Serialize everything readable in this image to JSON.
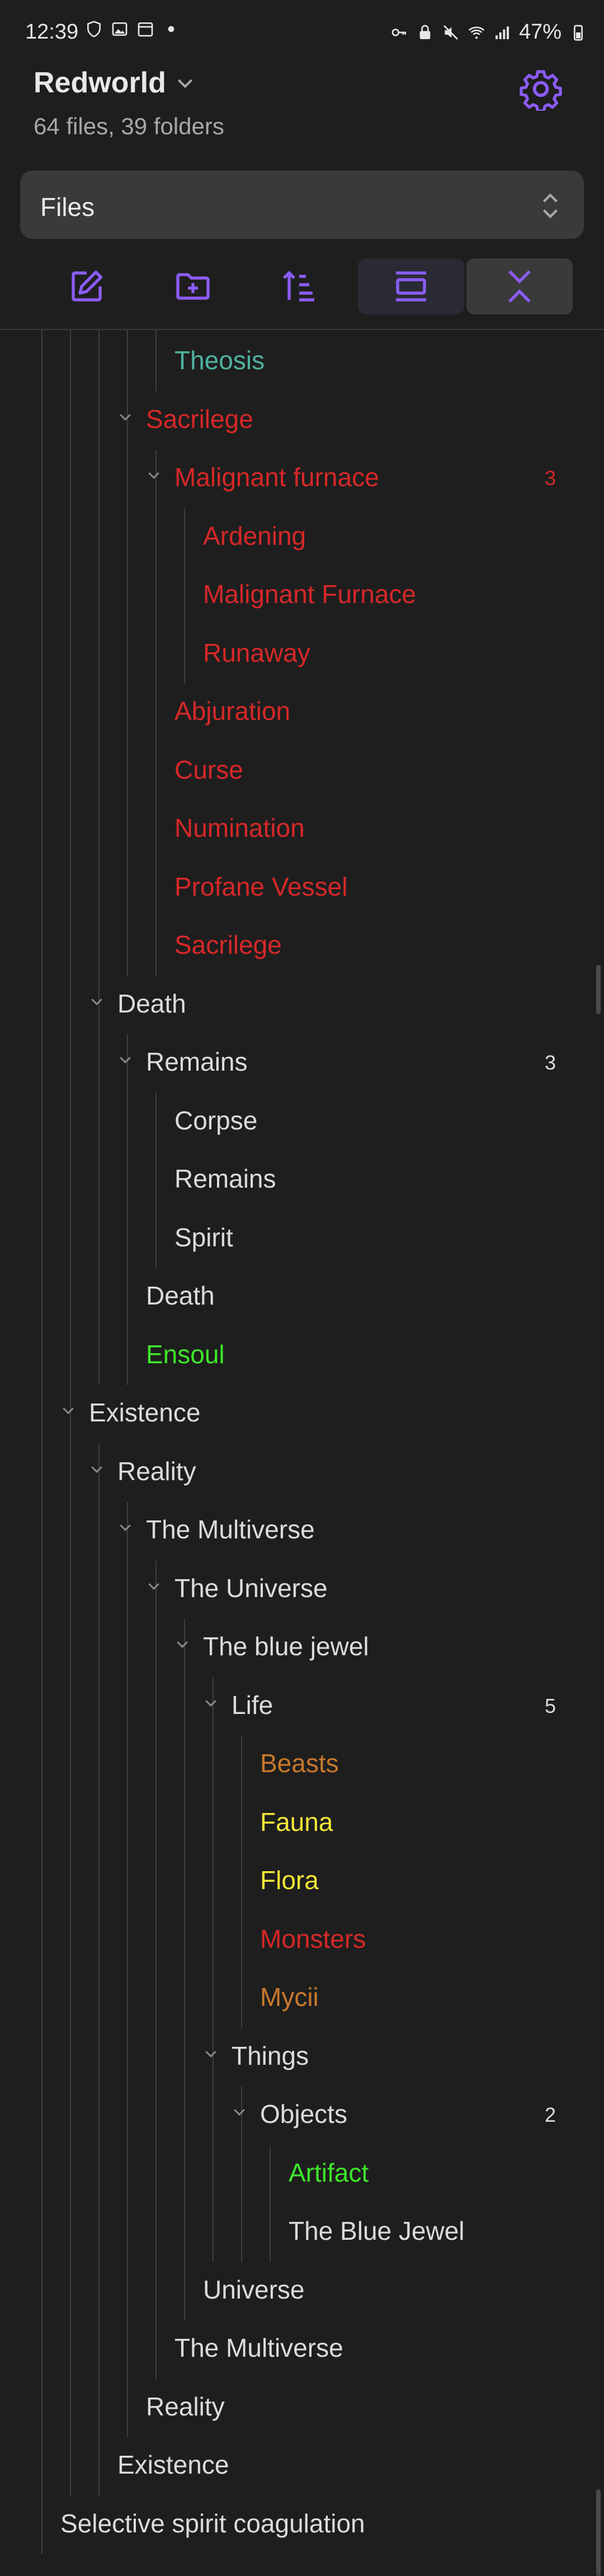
{
  "status": {
    "time": "12:39",
    "battery": "47%"
  },
  "header": {
    "vault_name": "Redworld",
    "stats": "64 files, 39 folders"
  },
  "view_selector": {
    "value": "Files"
  },
  "toolbar": [
    "new-note",
    "new-folder",
    "sort",
    "collapse-view",
    "collapse-all"
  ],
  "tree": [
    {
      "label": "Theosis",
      "color": "teal",
      "level": 6,
      "folder": false
    },
    {
      "label": "Sacrilege",
      "color": "red",
      "level": 5,
      "folder": true
    },
    {
      "label": "Malignant furnace",
      "color": "red",
      "level": 6,
      "folder": true,
      "count": "3"
    },
    {
      "label": "Ardening",
      "color": "red",
      "level": 7,
      "folder": false
    },
    {
      "label": "Malignant Furnace",
      "color": "red",
      "level": 7,
      "folder": false
    },
    {
      "label": "Runaway",
      "color": "red",
      "level": 7,
      "folder": false
    },
    {
      "label": "Abjuration",
      "color": "red",
      "level": 6,
      "folder": false
    },
    {
      "label": "Curse",
      "color": "red",
      "level": 6,
      "folder": false
    },
    {
      "label": "Numination",
      "color": "red",
      "level": 6,
      "folder": false
    },
    {
      "label": "Profane Vessel",
      "color": "red",
      "level": 6,
      "folder": false
    },
    {
      "label": "Sacrilege",
      "color": "red",
      "level": 6,
      "folder": false
    },
    {
      "label": "Death",
      "color": "default",
      "level": 4,
      "folder": true
    },
    {
      "label": "Remains",
      "color": "default",
      "level": 5,
      "folder": true,
      "count": "3"
    },
    {
      "label": "Corpse",
      "color": "default",
      "level": 6,
      "folder": false
    },
    {
      "label": "Remains",
      "color": "default",
      "level": 6,
      "folder": false
    },
    {
      "label": "Spirit",
      "color": "default",
      "level": 6,
      "folder": false
    },
    {
      "label": "Death",
      "color": "default",
      "level": 5,
      "folder": false
    },
    {
      "label": "Ensoul",
      "color": "green",
      "level": 5,
      "folder": false
    },
    {
      "label": "Existence",
      "color": "default",
      "level": 3,
      "folder": true
    },
    {
      "label": "Reality",
      "color": "default",
      "level": 4,
      "folder": true
    },
    {
      "label": "The Multiverse",
      "color": "default",
      "level": 5,
      "folder": true
    },
    {
      "label": "The Universe",
      "color": "default",
      "level": 6,
      "folder": true
    },
    {
      "label": "The blue jewel",
      "color": "default",
      "level": 7,
      "folder": true
    },
    {
      "label": "Life",
      "color": "default",
      "level": 8,
      "folder": true,
      "count": "5"
    },
    {
      "label": "Beasts",
      "color": "orange",
      "level": 9,
      "folder": false
    },
    {
      "label": "Fauna",
      "color": "yellow",
      "level": 9,
      "folder": false
    },
    {
      "label": "Flora",
      "color": "yellow",
      "level": 9,
      "folder": false
    },
    {
      "label": "Monsters",
      "color": "red",
      "level": 9,
      "folder": false
    },
    {
      "label": "Mycii",
      "color": "orange",
      "level": 9,
      "folder": false
    },
    {
      "label": "Things",
      "color": "default",
      "level": 8,
      "folder": true
    },
    {
      "label": "Objects",
      "color": "default",
      "level": 9,
      "folder": true,
      "count": "2"
    },
    {
      "label": "Artifact",
      "color": "green",
      "level": 10,
      "folder": false
    },
    {
      "label": "The Blue Jewel",
      "color": "default",
      "level": 10,
      "folder": false
    },
    {
      "label": "Universe",
      "color": "default",
      "level": 7,
      "folder": false
    },
    {
      "label": "The Multiverse",
      "color": "default",
      "level": 6,
      "folder": false
    },
    {
      "label": "Reality",
      "color": "default",
      "level": 5,
      "folder": false
    },
    {
      "label": "Existence",
      "color": "default",
      "level": 4,
      "folder": false
    },
    {
      "label": "Selective spirit coagulation",
      "color": "default",
      "level": 2,
      "folder": false
    }
  ]
}
